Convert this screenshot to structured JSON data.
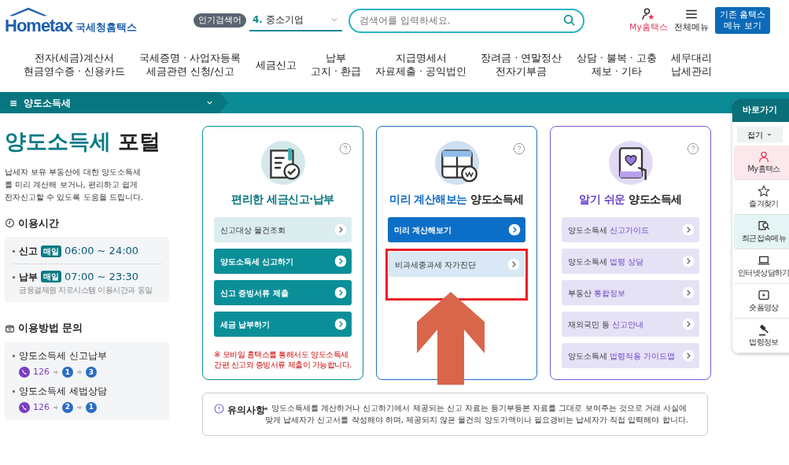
{
  "header": {
    "logo": "Hometax",
    "logo_caption": "국세청홈택스",
    "popular_label": "인기검색어",
    "popular_value": "4. 중소기업",
    "search": {
      "placeholder": "검색어를 입력하세요."
    },
    "my_link": "My홈택스",
    "menu_link": "전체메뉴",
    "legacy_button": "기존 홈택스 메뉴 보기"
  },
  "nav": [
    {
      "lines": [
        "전자(세금)계산서",
        "현금영수증 · 신용카드"
      ]
    },
    {
      "lines": [
        "국세증명 · 사업자등록",
        "세금관련 신청/신고"
      ]
    },
    {
      "lines": [
        "세금신고"
      ]
    },
    {
      "lines": [
        "납부",
        "고지 · 환급"
      ]
    },
    {
      "lines": [
        "지급명세서",
        "자료제출 · 공익법인"
      ]
    },
    {
      "lines": [
        "장려금 · 연말정산",
        "전자기부금"
      ]
    },
    {
      "lines": [
        "상담 · 불복 · 고충",
        "제보 · 기타"
      ]
    },
    {
      "lines": [
        "세무대리",
        "납세관리"
      ]
    }
  ],
  "breadcrumb": {
    "menu_glyph": "≡",
    "label": "양도소득세"
  },
  "intro": {
    "title_accent": "양도소득세",
    "title_rest": "포털",
    "description": "납세자 보유 부동산에 대한 양도소득세를 미리 계산해 보거나, 편리하고 쉽게 전자신고할 수 있도록 도움을 드립니다."
  },
  "hours": {
    "heading": "이용시간",
    "rows": [
      {
        "label": "신고",
        "badge": "매일",
        "time": "06:00 ~ 24:00"
      },
      {
        "label": "납부",
        "badge": "매일",
        "time": "07:00 ~ 23:30",
        "note": "금융결제원 지로시스템 이용시간과 동일"
      }
    ]
  },
  "contact": {
    "heading": "이용방법 문의",
    "rows": [
      {
        "label": "양도소득세 신고납부",
        "number": "126",
        "steps": [
          "1",
          "3"
        ]
      },
      {
        "label": "양도소득세 세법상담",
        "number": "126",
        "steps": [
          "2",
          "1"
        ]
      }
    ]
  },
  "cards": [
    {
      "title_accent": "편리한 세금신고·납부",
      "items": [
        {
          "kind": "light",
          "label": "신고대상 물건조회",
          "highlighted": false
        },
        {
          "kind": "solid",
          "label": "양도소득세 신고하기",
          "highlighted": false
        },
        {
          "kind": "solid",
          "label": "신고 증빙서류 제출",
          "highlighted": false
        },
        {
          "kind": "solid",
          "label": "세금 납부하기",
          "highlighted": false
        }
      ],
      "note": "※ 모바일 홈택스를 통해서도 양도소득세 간편 신고와 증빙서류 제출이 가능합니다."
    },
    {
      "title_accent": "미리 계산해보는",
      "title_rest": "양도소득세",
      "items": [
        {
          "kind": "solid",
          "label": "미리 계산해보기",
          "highlighted": false
        },
        {
          "kind": "light",
          "label": "비과세중과세 자가진단",
          "highlighted": true
        }
      ],
      "arrow": true
    },
    {
      "title_accent": "알기 쉬운",
      "title_rest": "양도소득세",
      "items": [
        {
          "kind": "light",
          "label": "양도소득세",
          "accent": "신고가이드",
          "highlighted": false
        },
        {
          "kind": "light",
          "label": "양도소득세",
          "accent": "법령 상담",
          "highlighted": false
        },
        {
          "kind": "light",
          "label": "부동산",
          "accent": "통합정보",
          "highlighted": false
        },
        {
          "kind": "light",
          "label": "재외국민 등",
          "accent": "신고안내",
          "highlighted": false
        },
        {
          "kind": "light",
          "label": "양도소득세",
          "accent": "법령적용 가이드맵",
          "highlighted": false
        }
      ]
    }
  ],
  "notice": {
    "label": "유의사항",
    "text": "양도소득세를 계산하거나 신고하기에서 제공되는 신고 자료는 등기부등본 자료를 그대로 보여주는 것으로 거래 사실에 맞게 납세자가 신고서를 작성해야 하며, 제공되지 않은 물건의 양도가액이나 필요경비는 납세자가 직접 입력해야 합니다."
  },
  "quickbar": {
    "title": "바로가기",
    "fold": "접기",
    "items": [
      {
        "label": "My홈택스",
        "color": "#fce8ec"
      },
      {
        "label": "즐겨찾기"
      },
      {
        "label": "최근접속메뉴",
        "color": "#e5f4f4"
      },
      {
        "label": "인터넷상담하기"
      },
      {
        "label": "숏폼영상"
      },
      {
        "label": "법령정보"
      }
    ]
  }
}
